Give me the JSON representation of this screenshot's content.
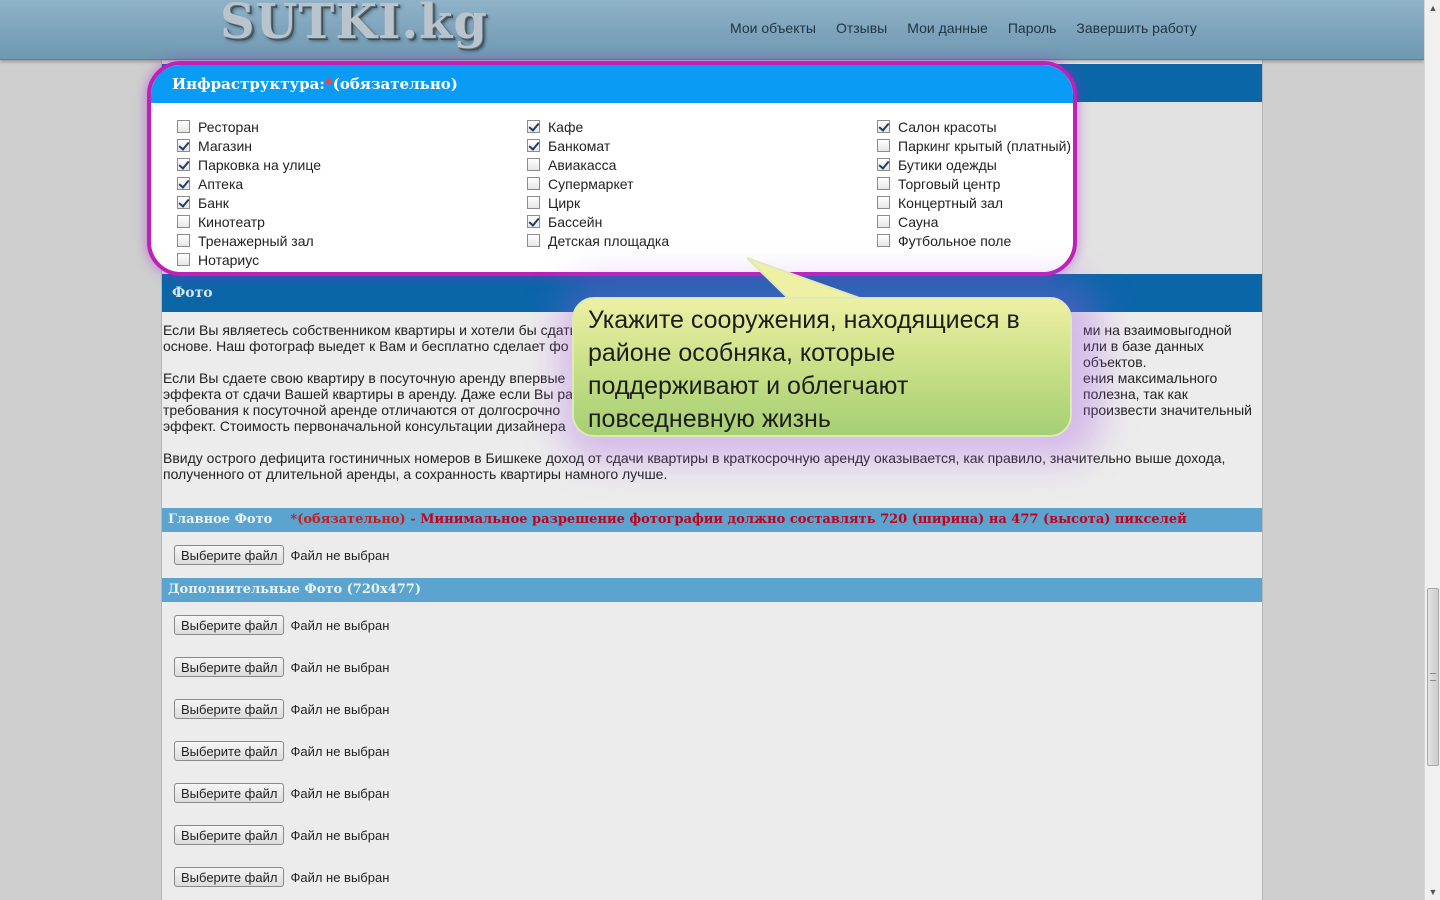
{
  "header": {
    "logo": "SUTKI.kg",
    "nav": [
      "Мои объекты",
      "Отзывы",
      "Мои данные",
      "Пароль",
      "Завершить работу"
    ]
  },
  "infrastructure": {
    "title": "Инфраструктура:",
    "required_mark": "*",
    "required_note": "(обязательно)",
    "columns": [
      [
        {
          "label": "Ресторан",
          "checked": false
        },
        {
          "label": "Магазин",
          "checked": true
        },
        {
          "label": "Парковка на улице",
          "checked": true
        },
        {
          "label": "Аптека",
          "checked": true
        },
        {
          "label": "Банк",
          "checked": true
        },
        {
          "label": "Кинотеатр",
          "checked": false
        },
        {
          "label": "Тренажерный зал",
          "checked": false
        },
        {
          "label": "Нотариус",
          "checked": false
        }
      ],
      [
        {
          "label": "Кафе",
          "checked": true
        },
        {
          "label": "Банкомат",
          "checked": true
        },
        {
          "label": "Авиакасса",
          "checked": false
        },
        {
          "label": "Супермаркет",
          "checked": false
        },
        {
          "label": "Цирк",
          "checked": false
        },
        {
          "label": "Бассейн",
          "checked": true
        },
        {
          "label": "Детская площадка",
          "checked": false
        }
      ],
      [
        {
          "label": "Салон красоты",
          "checked": true
        },
        {
          "label": "Паркинг крытый (платный)",
          "checked": false
        },
        {
          "label": "Бутики одежды",
          "checked": true
        },
        {
          "label": "Торговый центр",
          "checked": false
        },
        {
          "label": "Концертный зал",
          "checked": false
        },
        {
          "label": "Сауна",
          "checked": false
        },
        {
          "label": "Футбольное поле",
          "checked": false
        }
      ]
    ]
  },
  "photo": {
    "title": "Фото",
    "para1_line1": "Если Вы являетесь собственником квартиры и хотели бы сдать",
    "para1_line1_end": "ми на взаимовыгодной",
    "para1_line2": "основе. Наш фотограф выедет к Вам и бесплатно сделает фо",
    "para1_line2_end": "или в базе данных объектов.",
    "para2_line1": "Если Вы сдаете свою квартиру в посуточную аренду впервые",
    "para2_line1_end": "ения максимального",
    "para2_line2": "эффекта от сдачи Вашей квартиры в аренду. Даже если Вы ра",
    "para2_line2_end": "полезна, так как",
    "para2_line3": "требования к посуточной аренде отличаются от долгосрочно",
    "para2_line3_end": "произвести значительный",
    "para2_line4": "эффект. Стоимость первоначальной консультации дизайнера",
    "para3_line1": "Ввиду острого дефицита гостиничных номеров в Бишкеке доход от сдачи квартиры в краткосрочную аренду оказывается, как правило, значительно выше дохода,",
    "para3_line2": "полученного от длительной аренды, а сохранность квартиры намного лучше."
  },
  "main_photo": {
    "label": "Главное Фото",
    "required": "*(обязательно) -",
    "warning": "Минимальное разрешение фотографии должно составлять 720 (ширина) на 477 (высота) пикселей",
    "button": "Выберите файл",
    "status": "Файл не выбран"
  },
  "extra_photos": {
    "label": "Дополнительные Фото (720x477)",
    "button": "Выберите файл",
    "status": "Файл не выбран"
  },
  "tooltip": {
    "text": "Укажите сооружения, находящиеся в районе особняка, которые поддерживают и облегчают повседневную жизнь"
  }
}
